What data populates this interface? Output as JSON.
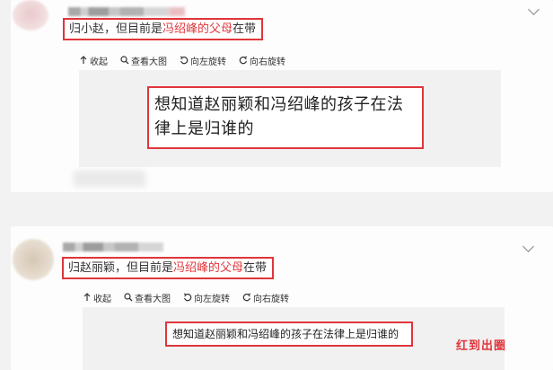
{
  "posts": [
    {
      "caption_prefix": "归小赵，但目前是",
      "caption_highlight": "冯绍峰的父母",
      "caption_suffix": "在带",
      "toolbar": {
        "collapse": "收起",
        "view_large": "查看大图",
        "rotate_left": "向左旋转",
        "rotate_right": "向右旋转"
      },
      "question_line1": "想知道赵丽颖和冯绍峰的孩子在法",
      "question_line2": "律上是归谁的"
    },
    {
      "caption_prefix": "归赵丽颖，但目前是",
      "caption_highlight": "冯绍峰的父母",
      "caption_suffix": "在带",
      "toolbar": {
        "collapse": "收起",
        "view_large": "查看大图",
        "rotate_left": "向左旋转",
        "rotate_right": "向右旋转"
      },
      "question": "想知道赵丽颖和冯绍峰的孩子在法律上是归谁的"
    }
  ],
  "watermark": "红到出圈",
  "colors": {
    "accent": "#e0353b",
    "background": "#f2f2f2"
  },
  "icons": [
    "collapse-arrow-icon",
    "zoom-icon",
    "rotate-left-icon",
    "rotate-right-icon",
    "chevron-down-icon"
  ]
}
